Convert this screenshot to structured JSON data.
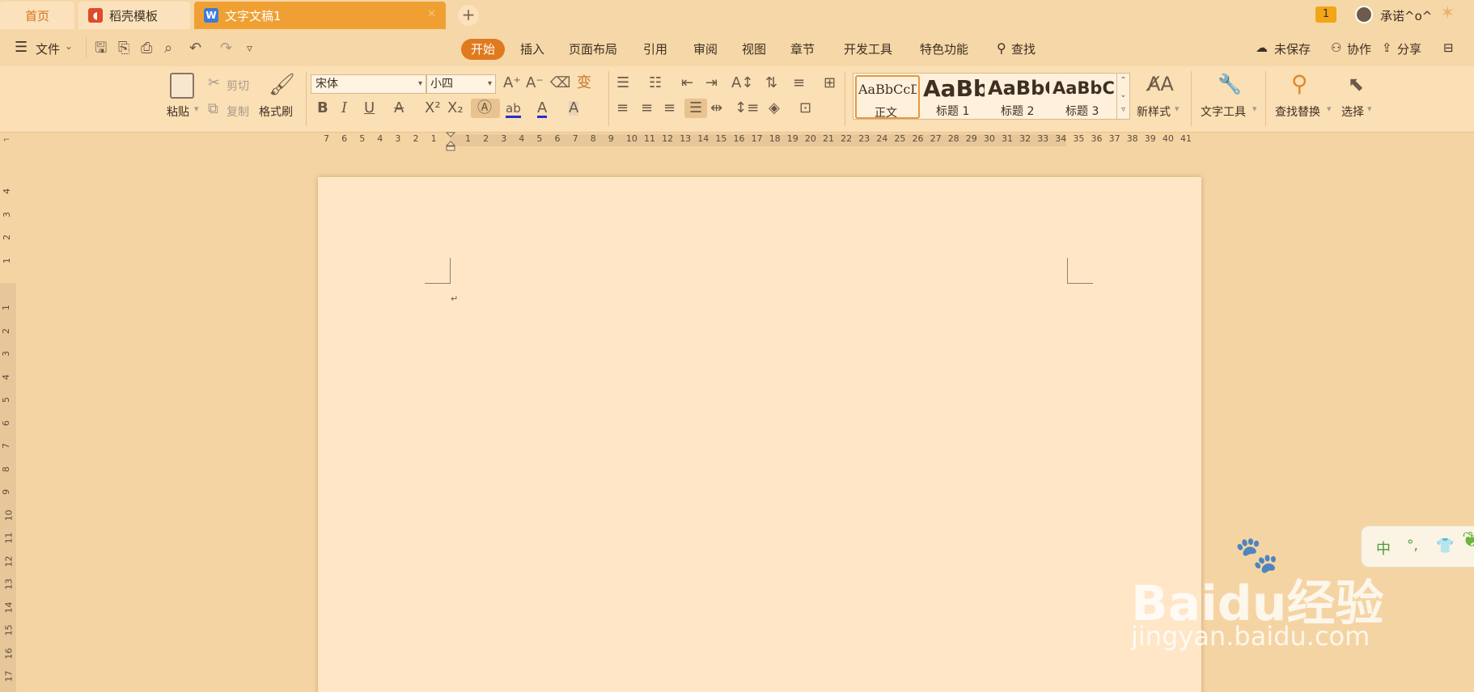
{
  "tabs": {
    "home": "首页",
    "daoke": "稻壳模板",
    "doc": "文字文稿1",
    "add": "+"
  },
  "titlebar": {
    "badge": "1",
    "user": "承诺^o^"
  },
  "menu": {
    "file": "文件",
    "tabs": [
      "开始",
      "插入",
      "页面布局",
      "引用",
      "审阅",
      "视图",
      "章节",
      "开发工具",
      "特色功能"
    ],
    "active": "开始",
    "search": "查找",
    "unsaved": "未保存",
    "collab": "协作",
    "share": "分享"
  },
  "ribbon": {
    "paste": "粘贴",
    "cut": "剪切",
    "copy": "复制",
    "format_painter": "格式刷",
    "font_name": "宋体",
    "font_size": "小四",
    "styles": [
      {
        "preview": "AaBbCcDd",
        "label": "正文"
      },
      {
        "preview": "AaBb",
        "label": "标题 1"
      },
      {
        "preview": "AaBbC",
        "label": "标题 2"
      },
      {
        "preview": "AaBbCc",
        "label": "标题 3"
      }
    ],
    "new_style": "新样式",
    "text_tools": "文字工具",
    "find_replace": "查找替换",
    "select": "选择"
  },
  "ruler": {
    "top_left": [
      "7",
      "6",
      "5",
      "4",
      "3",
      "2",
      "1"
    ],
    "top_right": [
      "1",
      "2",
      "3",
      "4",
      "5",
      "6",
      "7",
      "8",
      "9",
      "10",
      "11",
      "12",
      "13",
      "14",
      "15",
      "16",
      "17",
      "18",
      "19",
      "20",
      "21",
      "22",
      "23",
      "24",
      "25",
      "26",
      "27",
      "28",
      "29",
      "30",
      "31",
      "32",
      "33",
      "34",
      "35",
      "36",
      "37",
      "38",
      "39",
      "40",
      "41"
    ],
    "left_top": [
      "4",
      "3",
      "2",
      "1"
    ],
    "left_bottom": [
      "1",
      "2",
      "3",
      "4",
      "5",
      "6",
      "7",
      "8",
      "9",
      "10",
      "11",
      "12",
      "13",
      "14",
      "15",
      "16",
      "17"
    ]
  },
  "document": {
    "paragraph_mark": "↵"
  },
  "ime": {
    "mode": "中",
    "punct": "°,"
  },
  "watermark": {
    "brand": "Baidu经验",
    "url": "jingyan.baidu.com"
  },
  "colors": {
    "accent": "#f0a033",
    "active_tab": "#e07a1e",
    "page": "#fee6c7",
    "ribbon": "#fbdfb5"
  }
}
